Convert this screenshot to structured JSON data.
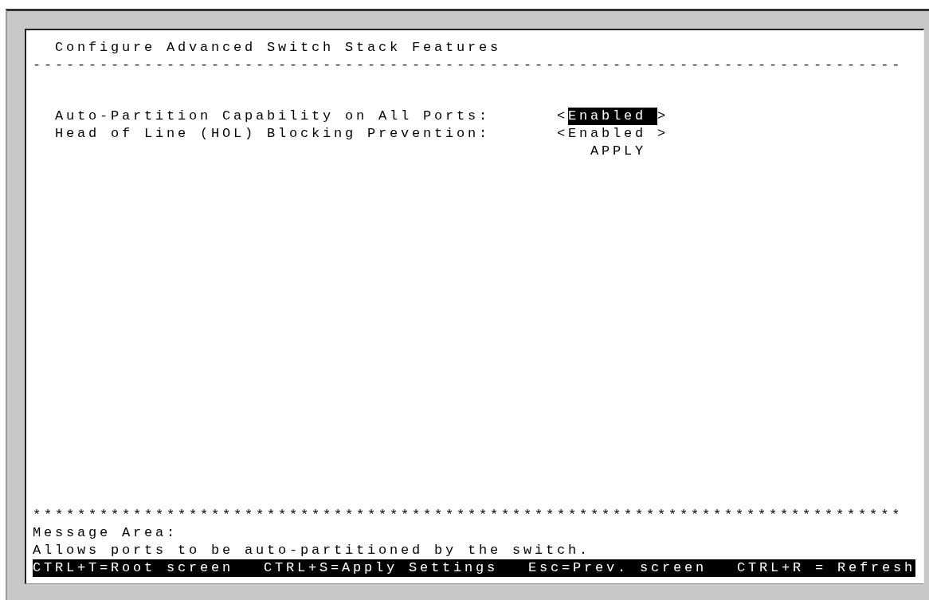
{
  "title": "Configure Advanced Switch Stack Features",
  "title_rule": "------------------------------------------------------------------------------",
  "settings": [
    {
      "label": "Auto-Partition Capability on All Ports:",
      "left_bracket": "<",
      "value": "Enabled",
      "right_bracket": ">",
      "selected": true
    },
    {
      "label": "Head of Line (HOL) Blocking Prevention:",
      "left_bracket": "<",
      "value": "Enabled",
      "right_bracket": ">",
      "selected": false
    }
  ],
  "apply_button": "APPLY",
  "message_rule": "******************************************************************************",
  "message_area": {
    "heading": "Message Area:",
    "text": "Allows ports to be auto-partitioned by the switch."
  },
  "shortcuts": [
    "CTRL+T=Root screen",
    "CTRL+S=Apply Settings",
    "Esc=Prev. screen",
    "CTRL+R = Refresh"
  ]
}
